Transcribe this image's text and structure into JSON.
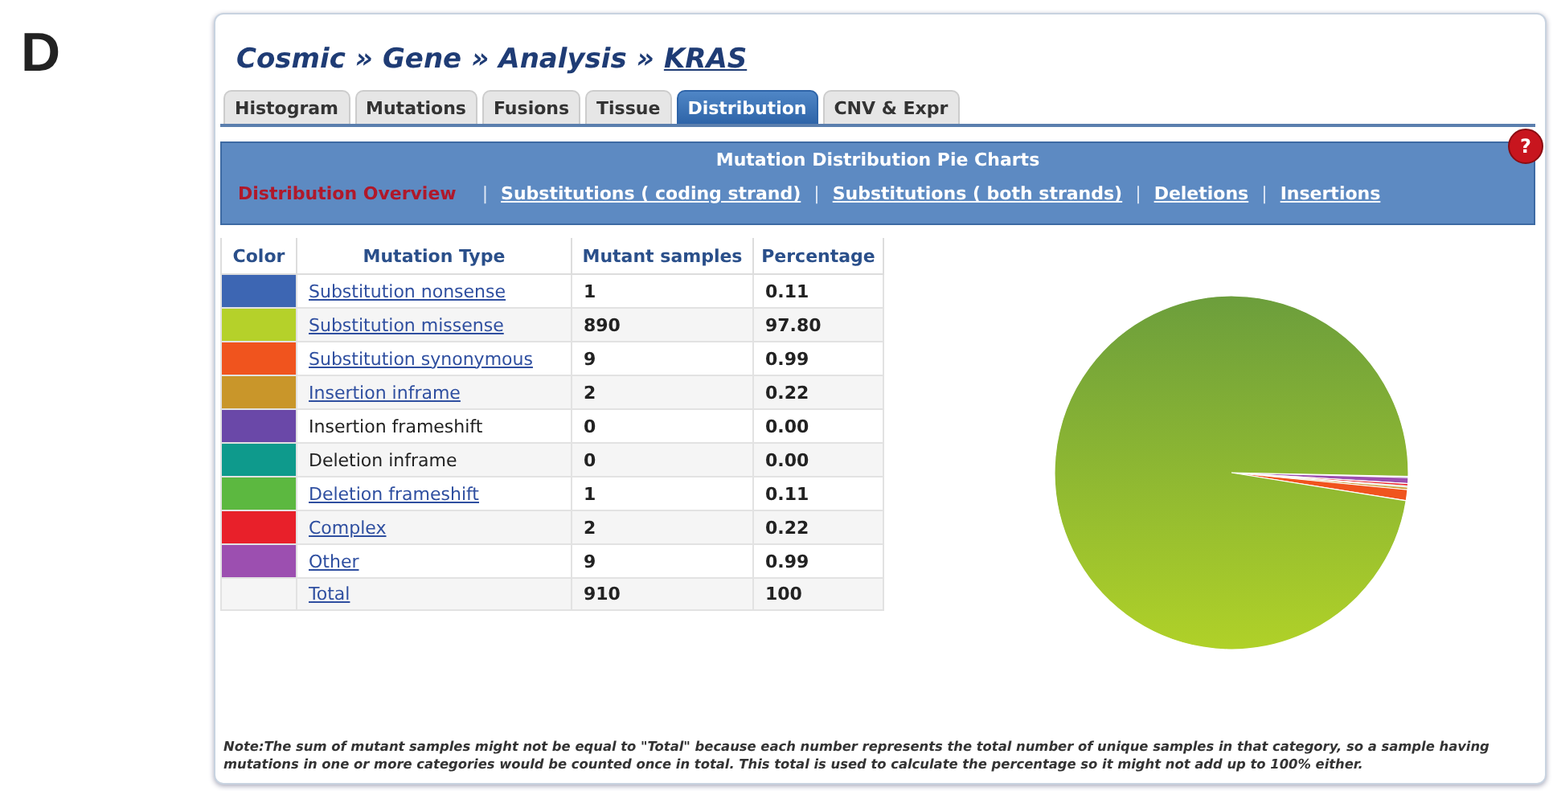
{
  "figure_label": "D",
  "breadcrumb": [
    {
      "text": "Cosmic",
      "link": false
    },
    {
      "text": "Gene",
      "link": false
    },
    {
      "text": "Analysis",
      "link": false
    },
    {
      "text": "KRAS",
      "link": true
    }
  ],
  "breadcrumb_separator": "»",
  "tabs": [
    {
      "label": "Histogram",
      "selected": false
    },
    {
      "label": "Mutations",
      "selected": false
    },
    {
      "label": "Fusions",
      "selected": false
    },
    {
      "label": "Tissue",
      "selected": false
    },
    {
      "label": "Distribution",
      "selected": true
    },
    {
      "label": "CNV & Expr",
      "selected": false
    }
  ],
  "panel": {
    "title": "Mutation Distribution Pie Charts",
    "help": "?",
    "links": [
      {
        "label": "Distribution Overview",
        "selected": true
      },
      {
        "label": "Substitutions ( coding strand)",
        "selected": false
      },
      {
        "label": "Substitutions ( both strands)",
        "selected": false
      },
      {
        "label": "Deletions",
        "selected": false
      },
      {
        "label": "Insertions",
        "selected": false
      }
    ],
    "separator": "|"
  },
  "table": {
    "columns": [
      "Color",
      "Mutation Type",
      "Mutant samples",
      "Percentage"
    ],
    "rows": [
      {
        "color": "#3d66b3",
        "type": "Substitution nonsense",
        "link": true,
        "samples": "1",
        "percentage": "0.11"
      },
      {
        "color": "#b5d12a",
        "type": "Substitution missense",
        "link": true,
        "samples": "890",
        "percentage": "97.80"
      },
      {
        "color": "#f0541e",
        "type": "Substitution synonymous",
        "link": true,
        "samples": "9",
        "percentage": "0.99"
      },
      {
        "color": "#c9962a",
        "type": "Insertion inframe",
        "link": true,
        "samples": "2",
        "percentage": "0.22"
      },
      {
        "color": "#6a48a8",
        "type": "Insertion frameshift",
        "link": false,
        "samples": "0",
        "percentage": "0.00"
      },
      {
        "color": "#0e9a8c",
        "type": "Deletion inframe",
        "link": false,
        "samples": "0",
        "percentage": "0.00"
      },
      {
        "color": "#5cb840",
        "type": "Deletion frameshift",
        "link": true,
        "samples": "1",
        "percentage": "0.11"
      },
      {
        "color": "#e8202a",
        "type": "Complex",
        "link": true,
        "samples": "2",
        "percentage": "0.22"
      },
      {
        "color": "#9c4fb0",
        "type": "Other",
        "link": true,
        "samples": "9",
        "percentage": "0.99"
      },
      {
        "type": "Total",
        "link": true,
        "samples": "910",
        "percentage": "100"
      }
    ]
  },
  "note": "Note:The sum of mutant samples might not be equal to \"Total\" because each number represents the total number of unique samples in that category, so a sample having mutations in one or more categories would be counted once in total. This total is used to calculate the percentage so it might not add up to 100% either."
}
